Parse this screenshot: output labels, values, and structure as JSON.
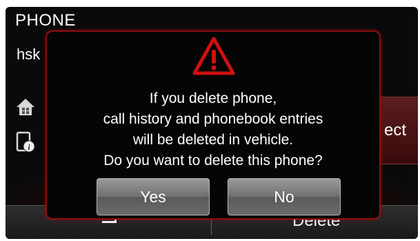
{
  "header": {
    "title": "PHONE",
    "subtitle": "hsk"
  },
  "sidebar": {
    "icons": [
      "home-icon",
      "phone-info-icon"
    ]
  },
  "right_button": {
    "label": "ect"
  },
  "bottom_bar": {
    "right_label": "Delete"
  },
  "dialog": {
    "icon": "warning-icon",
    "lines": [
      "If you delete phone,",
      "call history and phonebook entries",
      "will be deleted in vehicle.",
      "Do you want to delete this phone?"
    ],
    "yes_label": "Yes",
    "no_label": "No"
  },
  "colors": {
    "accent_red": "#d01010",
    "dialog_border": "#8a1010",
    "button_gray": "#7a7a7a"
  }
}
